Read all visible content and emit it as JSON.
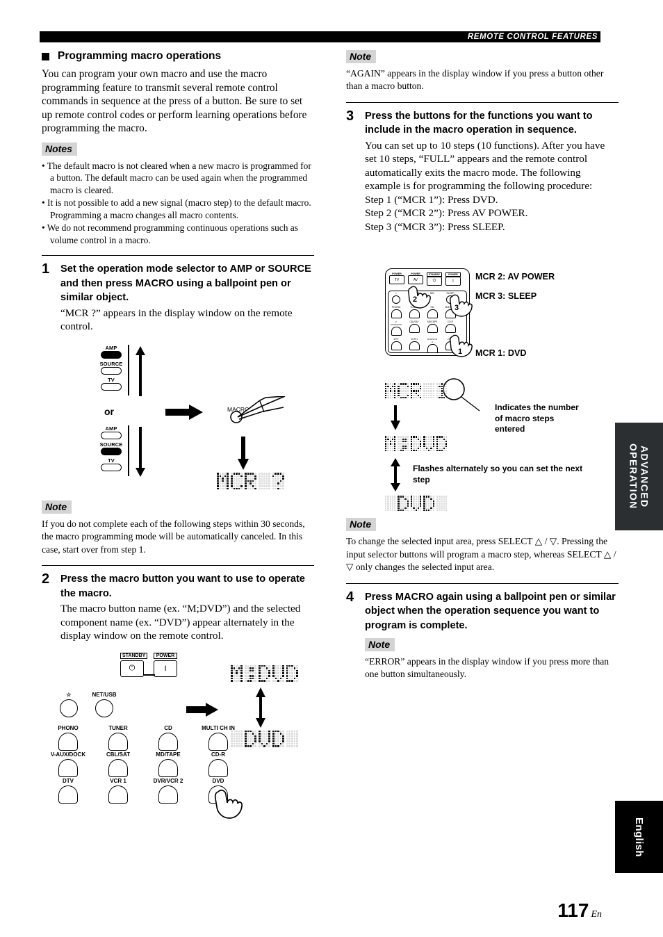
{
  "header": {
    "title": "REMOTE CONTROL FEATURES"
  },
  "section": {
    "heading": "Programming macro operations",
    "intro": "You can program your own macro and use the macro programming feature to transmit several remote control commands in sequence at the press of a button. Be sure to set up remote control codes or perform learning operations before programming the macro."
  },
  "notes_label": "Notes",
  "note_label": "Note",
  "notes_bullets": [
    "The default macro is not cleared when a new macro is programmed for a button. The default macro can be used again when the programmed macro is cleared.",
    "It is not possible to add a new signal (macro step) to the default macro. Programming a macro changes all macro contents.",
    "We do not recommend programming continuous operations such as volume control in a macro."
  ],
  "steps": {
    "one": {
      "number": "1",
      "heading": "Set the operation mode selector to AMP or SOURCE and then press MACRO using a ballpoint pen or similar object.",
      "text": "“MCR ?” appears in the display window on the remote control.",
      "note": "If you do not complete each of the following steps within 30 seconds, the macro programming mode will be automatically canceled. In this case, start over from step 1."
    },
    "two": {
      "number": "2",
      "heading": "Press the macro button you want to use to operate the macro.",
      "text": "The macro button name (ex. “M;DVD”) and the selected component name (ex. “DVD”) appear alternately in the display window on the remote control."
    },
    "three": {
      "number": "3",
      "heading": "Press the buttons for the functions you want to include in the macro operation in sequence.",
      "text": "You can set up to 10 steps (10 functions). After you have set 10 steps, “FULL” appears and the remote control automatically exits the macro mode. The following example is for programming the following procedure:",
      "proc1": "Step 1 (“MCR 1”): Press DVD.",
      "proc2": "Step 2 (“MCR 2”): Press AV POWER.",
      "proc3": "Step 3 (“MCR 3”): Press SLEEP.",
      "note": "To change the selected input area, press SELECT △ / ▽. Pressing the input selector buttons will program a macro step, whereas SELECT △ / ▽ only changes the selected input area."
    },
    "four": {
      "number": "4",
      "heading": "Press MACRO again using a ballpoint pen or similar object when the operation sequence you want to program is complete.",
      "note": "“ERROR” appears in the display window if you press more than one button simultaneously."
    }
  },
  "note_again": "“AGAIN” appears in the display window if you press a button other than a macro button.",
  "fig_selector": {
    "amp": "AMP",
    "source": "SOURCE",
    "tv": "TV",
    "or": "or",
    "macro": "MACRO"
  },
  "fig_keypad": {
    "standby": "STANDBY",
    "power": "POWER",
    "rows": [
      [
        "☆",
        "NET/USB"
      ],
      [
        "PHONO",
        "TUNER",
        "CD",
        "MULTI CH IN"
      ],
      [
        "V-AUX/DOCK",
        "CBL/SAT",
        "MD/TAPE",
        "CD-R"
      ],
      [
        "DTV",
        "VCR 1",
        "DVR/VCR 2",
        "DVD"
      ]
    ]
  },
  "fig_mini_remote": {
    "top_row": [
      "POWER",
      "POWER",
      "STANDBY",
      "POWER"
    ],
    "top_keys": [
      "TV",
      "AV",
      "",
      "I"
    ],
    "labels_r1": [
      "☆",
      "NET/USB",
      "SEL",
      "SLEEP"
    ],
    "labels_r2": [
      "PHONO",
      "TUNER",
      "CD",
      "MULTI CH"
    ],
    "labels_r3": [
      "V-AUX/DOCK",
      "CBL/SAT",
      "MD/TAPE",
      "CD-R"
    ],
    "labels_r4": [
      "DTV",
      "VCR 1",
      "DVR/VCR 2",
      "DVD"
    ],
    "markers": [
      "1",
      "2",
      "3"
    ],
    "callouts": {
      "mcr2": "MCR 2: AV POWER",
      "mcr3": "MCR 3: SLEEP",
      "mcr1": "MCR 1: DVD"
    }
  },
  "fig_display": {
    "lcd_mcr_q": "MCR ?",
    "lcd_mdvd": "M;DVD",
    "lcd_dvd": " DVD ",
    "lcd_mcr1": "MCR 1",
    "annot_steps": "Indicates the number of macro steps entered",
    "annot_flash": "Flashes alternately so you can set the next step"
  },
  "tabs": {
    "advanced": "ADVANCED OPERATION",
    "english": "English"
  },
  "page": {
    "number": "117",
    "suffix": "En"
  },
  "colors": {
    "header_bg": "#000000",
    "tab_bg": "#2b2f31",
    "note_bg": "#d4d4d4"
  }
}
